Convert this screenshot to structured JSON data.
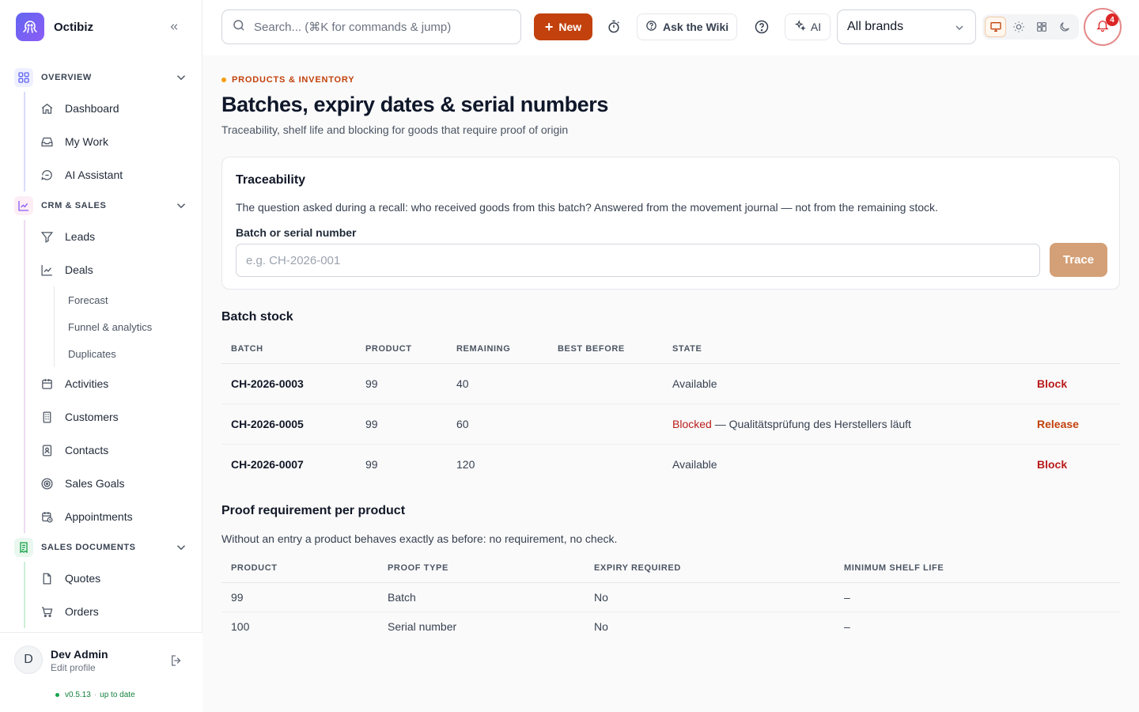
{
  "app": {
    "name": "Octibiz"
  },
  "sidebar": {
    "sections": [
      {
        "label": "OVERVIEW",
        "items": [
          {
            "label": "Dashboard"
          },
          {
            "label": "My Work"
          },
          {
            "label": "AI Assistant"
          }
        ]
      },
      {
        "label": "CRM & SALES",
        "items": [
          {
            "label": "Leads"
          },
          {
            "label": "Deals"
          },
          {
            "label": "Activities"
          },
          {
            "label": "Customers"
          },
          {
            "label": "Contacts"
          },
          {
            "label": "Sales Goals"
          },
          {
            "label": "Appointments"
          }
        ],
        "deal_subitems": [
          {
            "label": "Forecast"
          },
          {
            "label": "Funnel & analytics"
          },
          {
            "label": "Duplicates"
          }
        ]
      },
      {
        "label": "SALES DOCUMENTS",
        "items": [
          {
            "label": "Quotes"
          },
          {
            "label": "Orders"
          }
        ]
      }
    ],
    "user": {
      "initial": "D",
      "name": "Dev Admin",
      "subtitle": "Edit profile"
    },
    "version": {
      "number": "v0.5.13",
      "status": "up to date"
    }
  },
  "topbar": {
    "search_placeholder": "Search... (⌘K for commands & jump)",
    "new_label": "New",
    "wiki_label": "Ask the Wiki",
    "ai_label": "AI",
    "brand_select": "All brands",
    "notifications_count": "4"
  },
  "page": {
    "eyebrow": "PRODUCTS & INVENTORY",
    "title": "Batches, expiry dates & serial numbers",
    "subtitle": "Traceability, shelf life and blocking for goods that require proof of origin"
  },
  "traceability": {
    "title": "Traceability",
    "description": "The question asked during a recall: who received goods from this batch? Answered from the movement journal — not from the remaining stock.",
    "field_label": "Batch or serial number",
    "placeholder": "e.g. CH-2026-001",
    "button": "Trace"
  },
  "batch_stock": {
    "title": "Batch stock",
    "columns": {
      "batch": "BATCH",
      "product": "PRODUCT",
      "remaining": "REMAINING",
      "best_before": "BEST BEFORE",
      "state": "STATE"
    },
    "rows": [
      {
        "batch": "CH-2026-0003",
        "product": "99",
        "remaining": "40",
        "best_before": "",
        "state": "Available",
        "reason": "",
        "action": "Block"
      },
      {
        "batch": "CH-2026-0005",
        "product": "99",
        "remaining": "60",
        "best_before": "",
        "state": "Blocked",
        "reason": " — Qualitätsprüfung des Herstellers läuft",
        "action": "Release"
      },
      {
        "batch": "CH-2026-0007",
        "product": "99",
        "remaining": "120",
        "best_before": "",
        "state": "Available",
        "reason": "",
        "action": "Block"
      }
    ]
  },
  "proof": {
    "title": "Proof requirement per product",
    "description": "Without an entry a product behaves exactly as before: no requirement, no check.",
    "columns": {
      "product": "PRODUCT",
      "proof_type": "PROOF TYPE",
      "expiry_required": "EXPIRY REQUIRED",
      "min_shelf_life": "MINIMUM SHELF LIFE"
    },
    "rows": [
      {
        "product": "99",
        "proof_type": "Batch",
        "expiry_required": "No",
        "min_shelf_life": "–"
      },
      {
        "product": "100",
        "proof_type": "Serial number",
        "expiry_required": "No",
        "min_shelf_life": "–"
      }
    ]
  },
  "colors": {
    "accent": "#c2410c",
    "danger": "#b91c1c",
    "brand_logo": "#6366f1"
  }
}
